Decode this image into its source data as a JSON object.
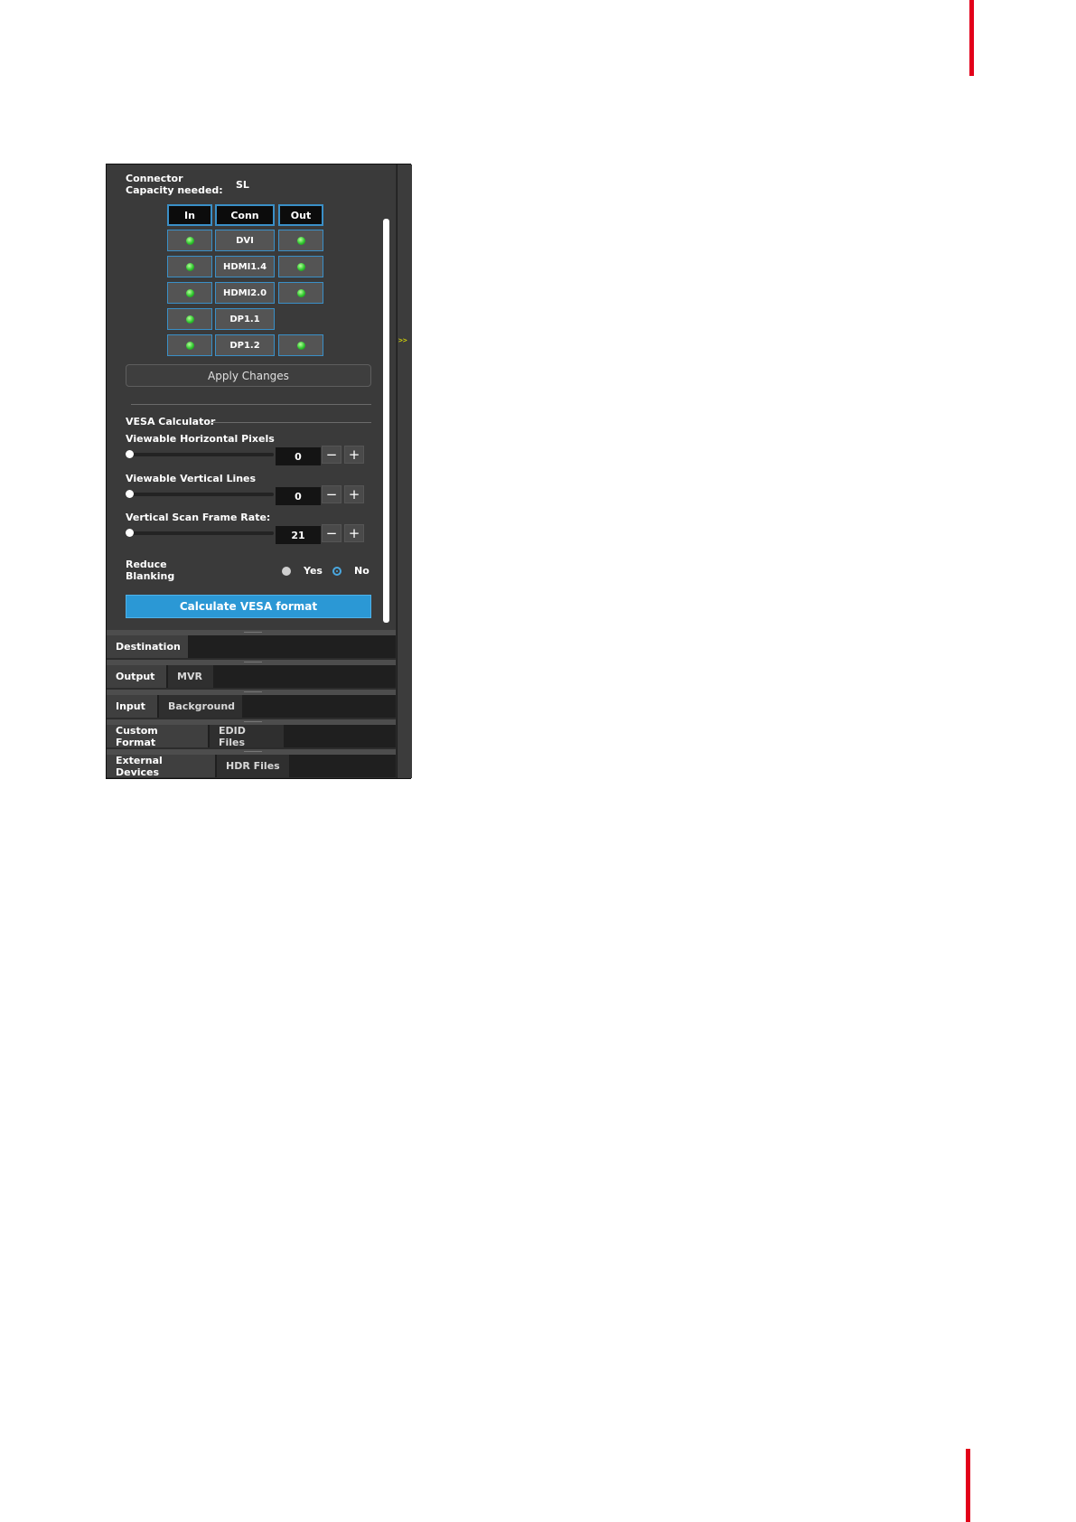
{
  "connector": {
    "label": "Connector\nCapacity needed:",
    "value": "SL"
  },
  "table": {
    "headers": [
      "In",
      "Conn",
      "Out"
    ],
    "rows": [
      {
        "conn": "DVI",
        "in": true,
        "out": true
      },
      {
        "conn": "HDMI1.4",
        "in": true,
        "out": true
      },
      {
        "conn": "HDMI2.0",
        "in": true,
        "out": true
      },
      {
        "conn": "DP1.1",
        "in": true,
        "out": false
      },
      {
        "conn": "DP1.2",
        "in": true,
        "out": true
      }
    ]
  },
  "apply_label": "Apply Changes",
  "vesa": {
    "title": "VESA Calculator",
    "fields": [
      {
        "label": "Viewable Horizontal Pixels",
        "value": "0"
      },
      {
        "label": "Viewable Vertical Lines",
        "value": "0"
      },
      {
        "label": "Vertical Scan Frame Rate:",
        "value": "21"
      }
    ],
    "reduce_label": "Reduce\nBlanking",
    "yes_label": "Yes",
    "no_label": "No",
    "selected": "No",
    "calc_label": "Calculate VESA format"
  },
  "stepper": {
    "minus": "−",
    "plus": "+"
  },
  "expander": ">>",
  "tabs": [
    [
      "Destination"
    ],
    [
      "Output",
      "MVR"
    ],
    [
      "Input",
      "Background"
    ],
    [
      "Custom Format",
      "EDID Files"
    ],
    [
      "External Devices",
      "HDR Files"
    ]
  ],
  "colors": {
    "accent": "#2b98d5",
    "brand_red": "#e2001a",
    "led_green": "#2ec52e"
  }
}
